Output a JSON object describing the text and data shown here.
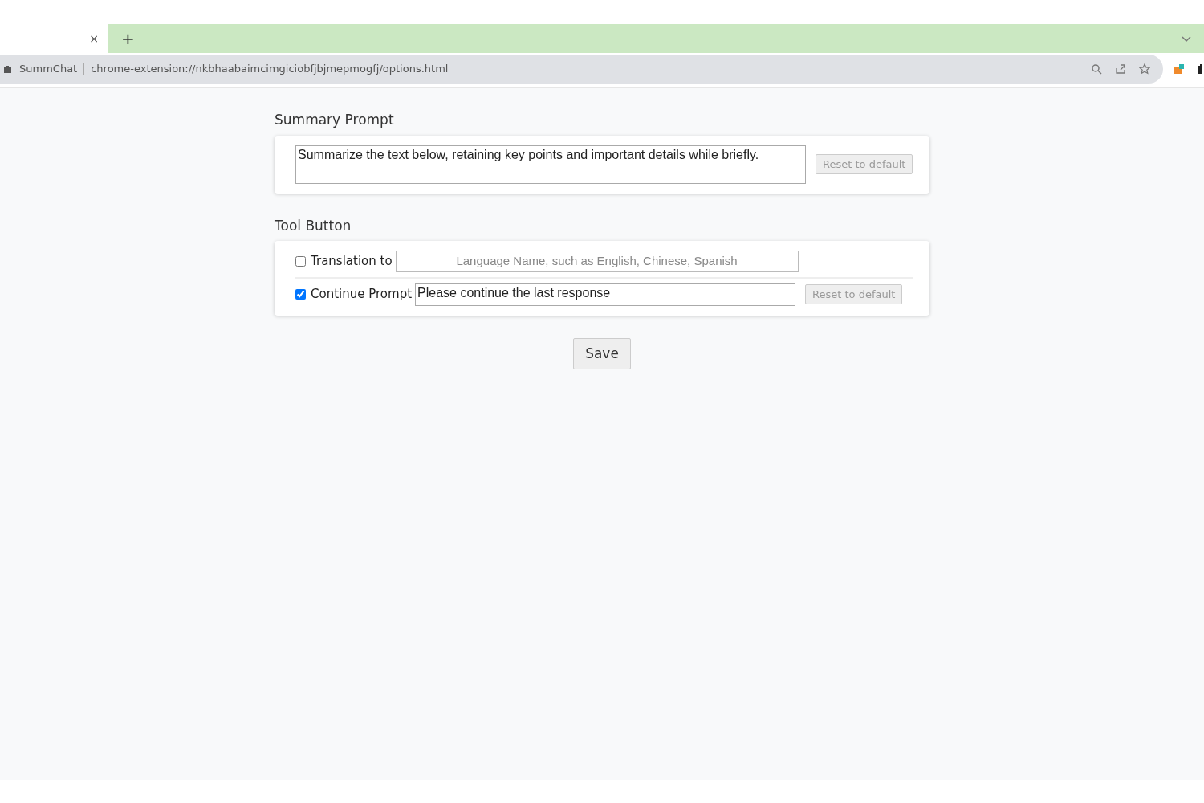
{
  "browser": {
    "tab_close": "×",
    "new_tab": "+",
    "site_name": "SummChat",
    "url": "chrome-extension://nkbhaabaimcimgiciobfjbjmepmogfj/options.html"
  },
  "sections": [
    {
      "title": "Summary Prompt",
      "rows": [
        {
          "kind": "textarea",
          "value": "Summarize the text below, retaining key points and important details while briefly.",
          "reset_label": "Reset to default"
        }
      ]
    },
    {
      "title": "Tool Button",
      "rows": [
        {
          "kind": "input",
          "label": "Translation to",
          "checked": false,
          "placeholder": "Language Name, such as English, Chinese, Spanish"
        },
        {
          "kind": "textarea",
          "label": "Continue Prompt",
          "checked": true,
          "value": "Please continue the last response",
          "reset_label": "Reset to default"
        }
      ]
    }
  ],
  "save_label": "Save"
}
